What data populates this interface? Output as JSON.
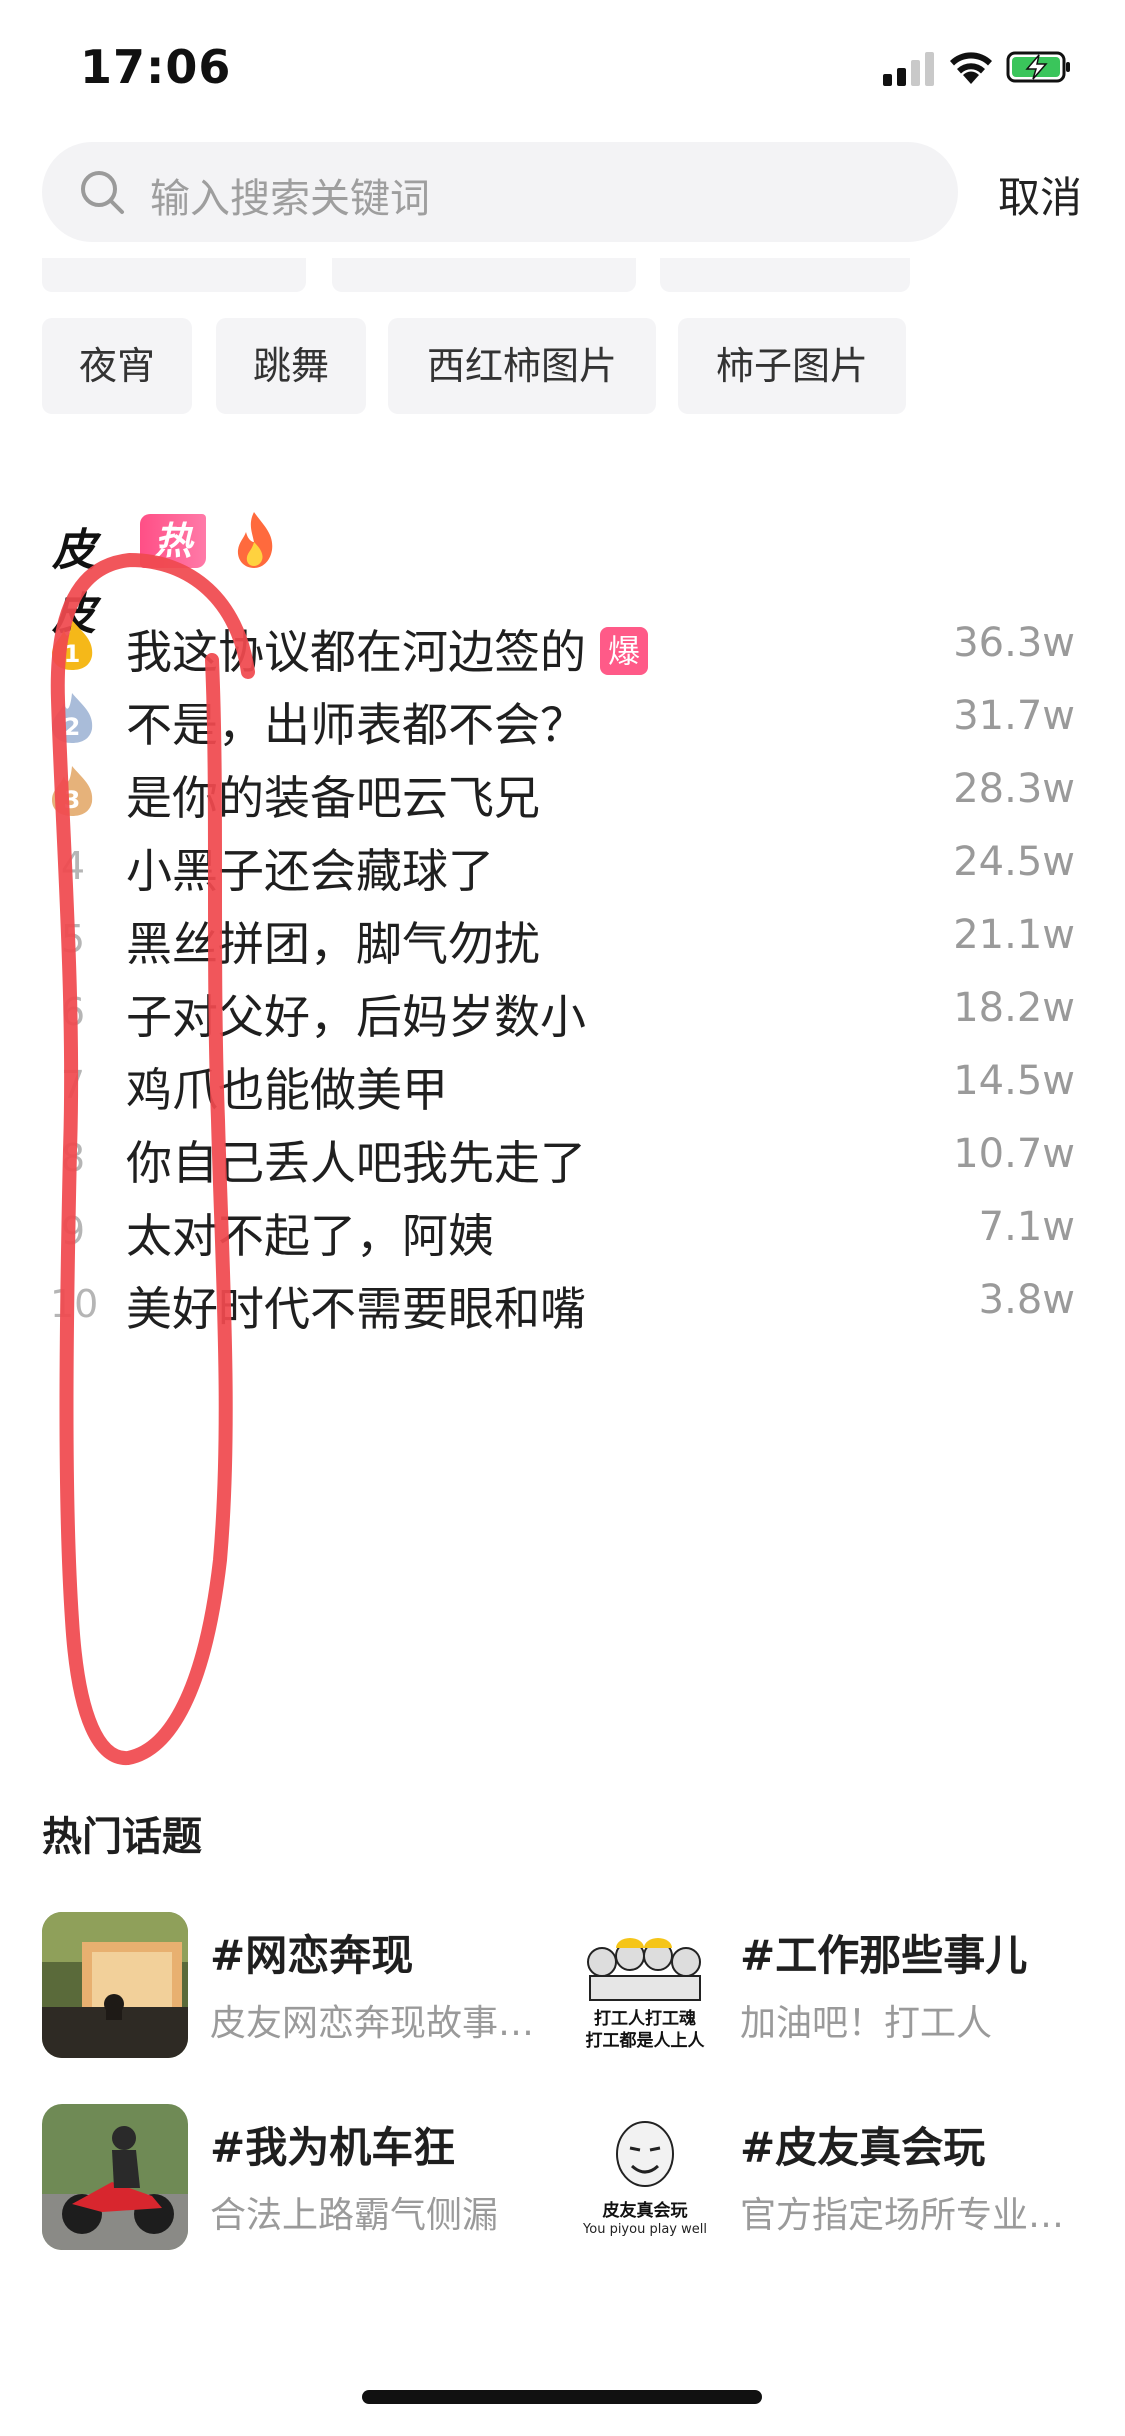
{
  "status_bar": {
    "time": "17:06"
  },
  "search": {
    "placeholder": "输入搜索关键词",
    "cancel_label": "取消"
  },
  "chips": [
    "夜宵",
    "跳舞",
    "西红柿图片",
    "柿子图片"
  ],
  "hot_list": {
    "brand": "皮皮",
    "badge": "热榜",
    "items": [
      {
        "rank": "1",
        "title": "我这协议都在河边签的",
        "tag": "爆",
        "count": "36.3w"
      },
      {
        "rank": "2",
        "title": "不是，出师表都不会？",
        "count": "31.7w"
      },
      {
        "rank": "3",
        "title": "是你的装备吧云飞兄",
        "count": "28.3w"
      },
      {
        "rank": "4",
        "title": "小黑子还会藏球了",
        "count": "24.5w"
      },
      {
        "rank": "5",
        "title": "黑丝拼团，脚气勿扰",
        "count": "21.1w"
      },
      {
        "rank": "6",
        "title": "子对父好，后妈岁数小",
        "count": "18.2w"
      },
      {
        "rank": "7",
        "title": "鸡爪也能做美甲",
        "count": "14.5w"
      },
      {
        "rank": "8",
        "title": "你自己丢人吧我先走了",
        "count": "10.7w"
      },
      {
        "rank": "9",
        "title": "太对不起了，阿姨",
        "count": "7.1w"
      },
      {
        "rank": "10",
        "title": "美好时代不需要眼和嘴",
        "count": "3.8w"
      }
    ]
  },
  "topics": {
    "section_title": "热门话题",
    "items": [
      {
        "name": "#网恋奔现",
        "desc": "皮友网恋奔现故事…"
      },
      {
        "name": "#工作那些事儿",
        "desc": "加油吧！打工人",
        "thumb_text_1": "打工人打工魂",
        "thumb_text_2": "打工都是人上人"
      },
      {
        "name": "#我为机车狂",
        "desc": "合法上路霸气侧漏"
      },
      {
        "name": "#皮友真会玩",
        "desc": "官方指定场所专业…",
        "thumb_text_1": "皮友真会玩",
        "thumb_text_2": "You piyou play well"
      }
    ]
  },
  "colors": {
    "brand_pink": "#ff4f86",
    "annotation_red": "#f0494f",
    "gold": "#f5b819"
  }
}
